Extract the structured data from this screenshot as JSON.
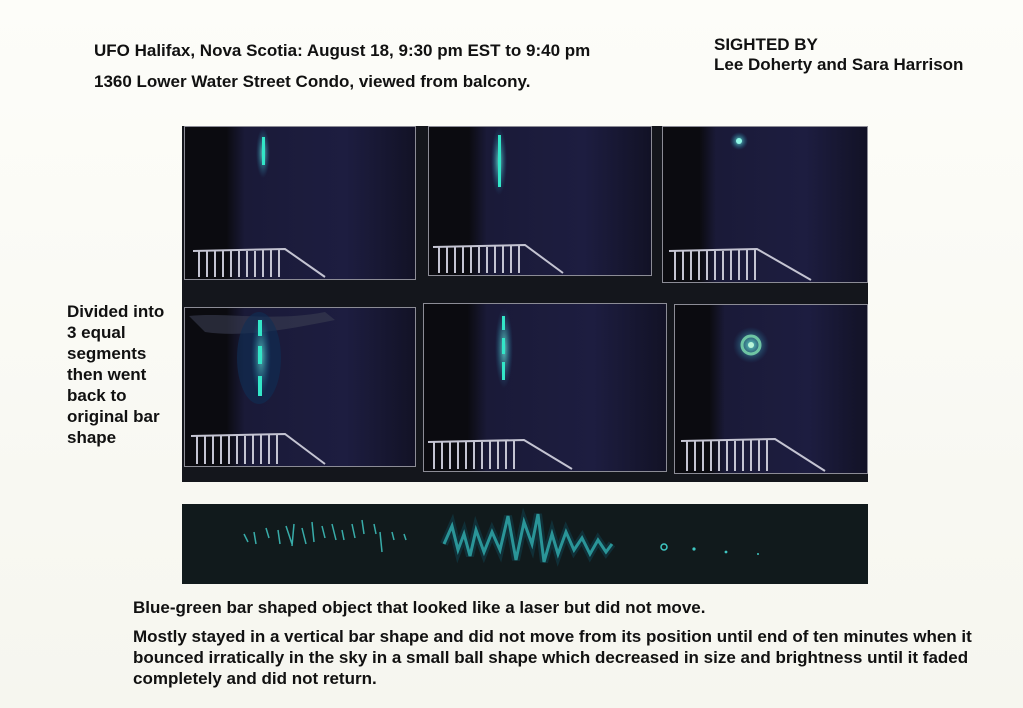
{
  "header": {
    "title_line1": "UFO Halifax, Nova Scotia: August 18, 9:30 pm EST to 9:40 pm",
    "title_line2": "1360 Lower Water Street Condo, viewed from balcony.",
    "sighted_by_label": "SIGHTED BY",
    "sighted_by_names": "Lee Doherty and Sara Harrison"
  },
  "side_note": "Divided into 3 equal segments then went back to original bar shape",
  "captions": {
    "line1": "Blue-green bar shaped object that looked like a laser but did not move.",
    "line2": "Mostly stayed in a vertical bar shape and did not move from its position until end of ten minutes when it bounced irratically in the sky in a small ball shape which decreased in size and brightness until it faded completely and did not return."
  },
  "colors": {
    "glow": "#33e6c8",
    "sky": "#1d1d40",
    "railing": "#c4c4d2",
    "frame": "#14161c"
  }
}
